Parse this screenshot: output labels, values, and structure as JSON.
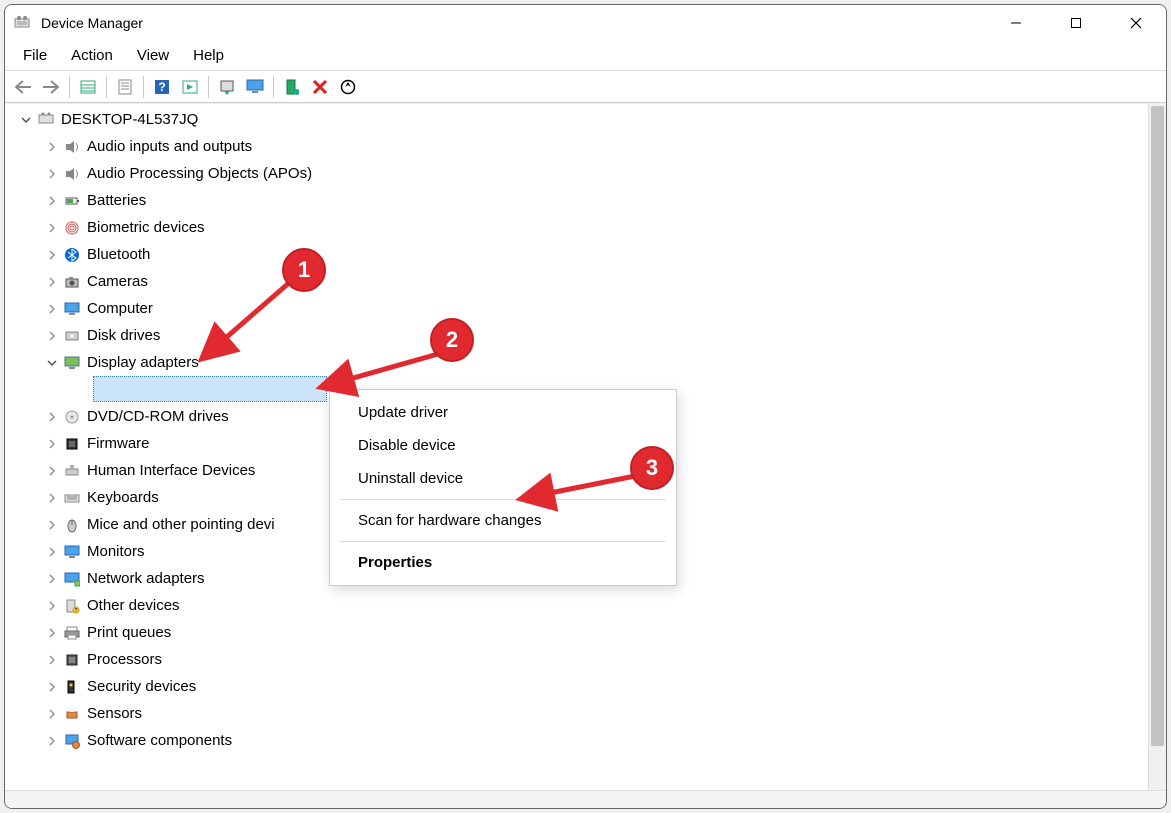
{
  "window": {
    "title": "Device Manager"
  },
  "menubar": {
    "items": [
      "File",
      "Action",
      "View",
      "Help"
    ]
  },
  "toolbar": {
    "back_icon": "←",
    "forward_icon": "→",
    "show_hidden_icon": "shh",
    "properties_icon": "prop",
    "help_icon": "?",
    "action_icon": "act",
    "update_icon": "upd",
    "disable_icon": "dis",
    "enable_icon": "en",
    "uninstall_icon": "✕",
    "scan_icon": "scan"
  },
  "tree": {
    "root": {
      "label": "DESKTOP-4L537JQ",
      "expanded": true
    },
    "items": [
      {
        "label": "Audio inputs and outputs",
        "icon": "speaker",
        "expanded": false
      },
      {
        "label": "Audio Processing Objects (APOs)",
        "icon": "speaker",
        "expanded": false
      },
      {
        "label": "Batteries",
        "icon": "battery",
        "expanded": false
      },
      {
        "label": "Biometric devices",
        "icon": "fingerprint",
        "expanded": false
      },
      {
        "label": "Bluetooth",
        "icon": "bluetooth",
        "expanded": false
      },
      {
        "label": "Cameras",
        "icon": "camera",
        "expanded": false
      },
      {
        "label": "Computer",
        "icon": "monitor",
        "expanded": false
      },
      {
        "label": "Disk drives",
        "icon": "disk",
        "expanded": false
      },
      {
        "label": "Display adapters",
        "icon": "display",
        "expanded": true
      },
      {
        "label": "DVD/CD-ROM drives",
        "icon": "disc",
        "expanded": false
      },
      {
        "label": "Firmware",
        "icon": "chip",
        "expanded": false
      },
      {
        "label": "Human Interface Devices",
        "icon": "hid",
        "expanded": false
      },
      {
        "label": "Keyboards",
        "icon": "keyboard",
        "expanded": false
      },
      {
        "label": "Mice and other pointing devi",
        "icon": "mouse",
        "expanded": false
      },
      {
        "label": "Monitors",
        "icon": "monitor",
        "expanded": false
      },
      {
        "label": "Network adapters",
        "icon": "network",
        "expanded": false
      },
      {
        "label": "Other devices",
        "icon": "other",
        "expanded": false
      },
      {
        "label": "Print queues",
        "icon": "printer",
        "expanded": false
      },
      {
        "label": "Processors",
        "icon": "cpu",
        "expanded": false
      },
      {
        "label": "Security devices",
        "icon": "security",
        "expanded": false
      },
      {
        "label": "Sensors",
        "icon": "sensor",
        "expanded": false
      },
      {
        "label": "Software components",
        "icon": "software",
        "expanded": false
      }
    ]
  },
  "contextMenu": {
    "items": [
      {
        "label": "Update driver",
        "type": "item"
      },
      {
        "label": "Disable device",
        "type": "item"
      },
      {
        "label": "Uninstall device",
        "type": "item"
      },
      {
        "type": "sep"
      },
      {
        "label": "Scan for hardware changes",
        "type": "item"
      },
      {
        "type": "sep"
      },
      {
        "label": "Properties",
        "type": "item",
        "bold": true
      }
    ]
  },
  "annotations": {
    "badges": [
      "1",
      "2",
      "3"
    ]
  }
}
